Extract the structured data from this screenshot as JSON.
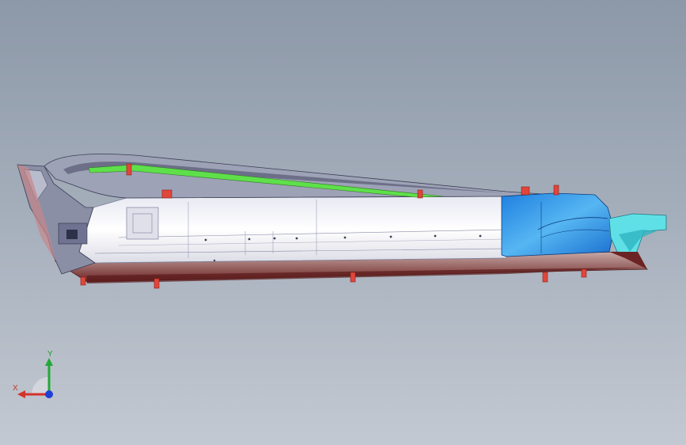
{
  "viewport": {
    "description_colors": {
      "background_top": "#8d98a8",
      "background_bottom": "#c3c9d2",
      "body_white": "#fbfbfd",
      "highlight_blue": "#2f8fe6",
      "cyan_part": "#5fe0e6",
      "green_strip": "#5fe04a",
      "red_pin": "#e0463c",
      "maroon_base": "#7a2a2a"
    }
  },
  "triad": {
    "x_label": "X",
    "y_label": "Y",
    "x_color": "#d4322c",
    "y_color": "#22a83a",
    "z_color": "#1f3fd6"
  }
}
